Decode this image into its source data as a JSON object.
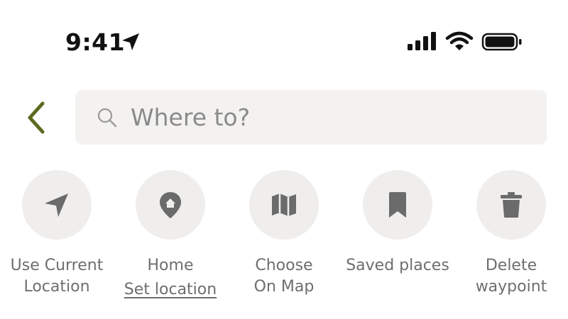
{
  "status_bar": {
    "time": "9:41",
    "icons": [
      "location-arrow-icon",
      "signal-icon",
      "wifi-icon",
      "battery-icon"
    ]
  },
  "header": {
    "back_icon": "chevron-left-icon",
    "accent_color": "#5b6b1e"
  },
  "search": {
    "placeholder": "Where to?",
    "icon": "search-icon"
  },
  "actions": [
    {
      "icon": "navigation-arrow-icon",
      "line1": "Use Current",
      "line2": "Location"
    },
    {
      "icon": "home-pin-icon",
      "line1": "Home",
      "link": "Set location"
    },
    {
      "icon": "map-icon",
      "line1": "Choose",
      "line2": "On Map"
    },
    {
      "icon": "bookmark-icon",
      "line1": "Saved places"
    },
    {
      "icon": "trash-icon",
      "line1": "Delete",
      "line2": "waypoint"
    }
  ]
}
